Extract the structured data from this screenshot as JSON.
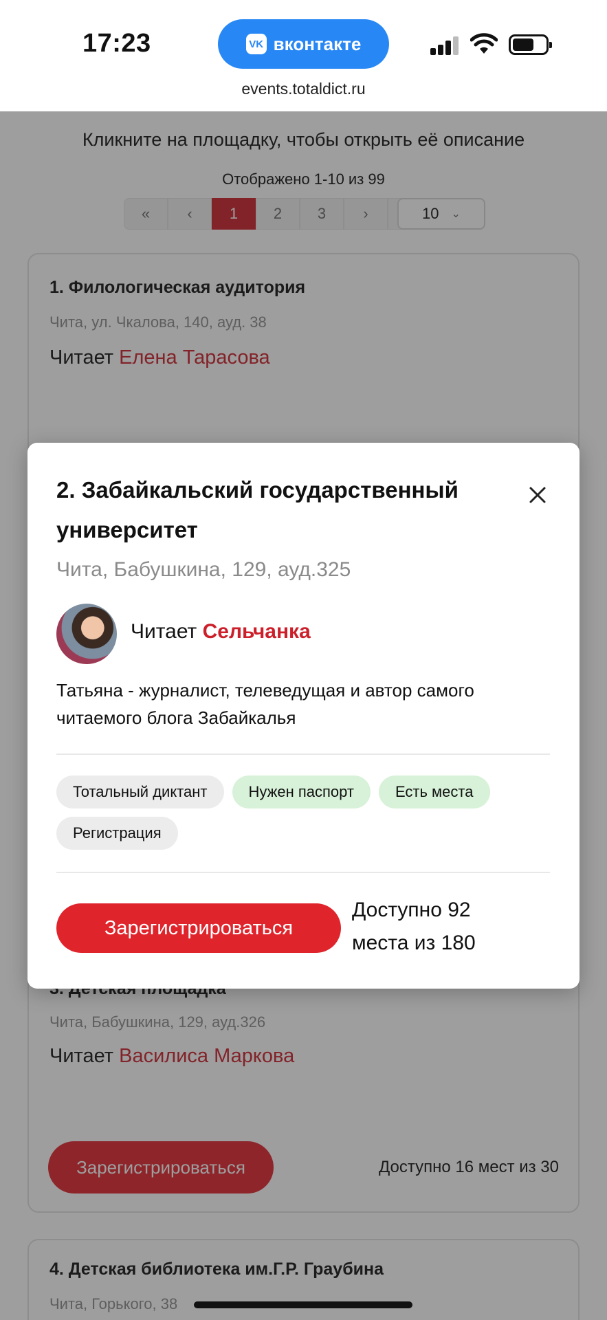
{
  "status_bar": {
    "time": "17:23",
    "app_pill": {
      "logo": "VK",
      "label": "вконтакте"
    },
    "url": "events.totaldict.ru",
    "icons": [
      "signal-icon",
      "wifi-icon",
      "battery-icon"
    ]
  },
  "page": {
    "hint": "Кликните на площадку, чтобы открыть её описание",
    "count": "Отображено 1-10 из 99",
    "pagination": {
      "first": "«",
      "prev": "‹",
      "pages": [
        "1",
        "2",
        "3"
      ],
      "active_page": "1",
      "next": "›",
      "last": "»",
      "per_page": "10",
      "per_page_chevron": "⌄"
    },
    "cards": [
      {
        "title": "1. Филологическая аудитория",
        "address": "Чита, ул. Чкалова, 140, ауд. 38",
        "reader_prefix": "Читает",
        "reader_name": "Елена Тарасова"
      },
      {
        "title": "3. Детская площадка",
        "address": "Чита, Бабушкина, 129, ауд.326",
        "reader_prefix": "Читает",
        "reader_name": "Василиса Маркова",
        "button": "Зарегистрироваться",
        "availability": "Доступно 16 мест из 30"
      },
      {
        "title": "4. Детская библиотека им.Г.Р. Граубина",
        "address": "Чита, Горького, 38"
      }
    ]
  },
  "modal": {
    "title": "2. Забайкальский государственный университет",
    "address": "Чита, Бабушкина, 129, ауд.325",
    "reader_prefix": "Читает",
    "reader_name": "Сельчанка",
    "description": "Татьяна - журналист, телеведущая и автор самого читаемого блога Забайкалья",
    "tags": [
      {
        "label": "Тотальный диктант",
        "color": "#ececec"
      },
      {
        "label": "Нужен паспорт",
        "color": "#d7f2d8"
      },
      {
        "label": "Есть места",
        "color": "#d7f2d8"
      },
      {
        "label": "Регистрация",
        "color": "#ececec"
      }
    ],
    "button": "Зарегистрироваться",
    "availability": "Доступно 92 места из 180"
  },
  "colors": {
    "accent_red": "#e0242c",
    "link_red": "#cc1f2a",
    "vk_blue": "#2787f5",
    "tag_green": "#d7f2d8",
    "tag_gray": "#ececec"
  }
}
